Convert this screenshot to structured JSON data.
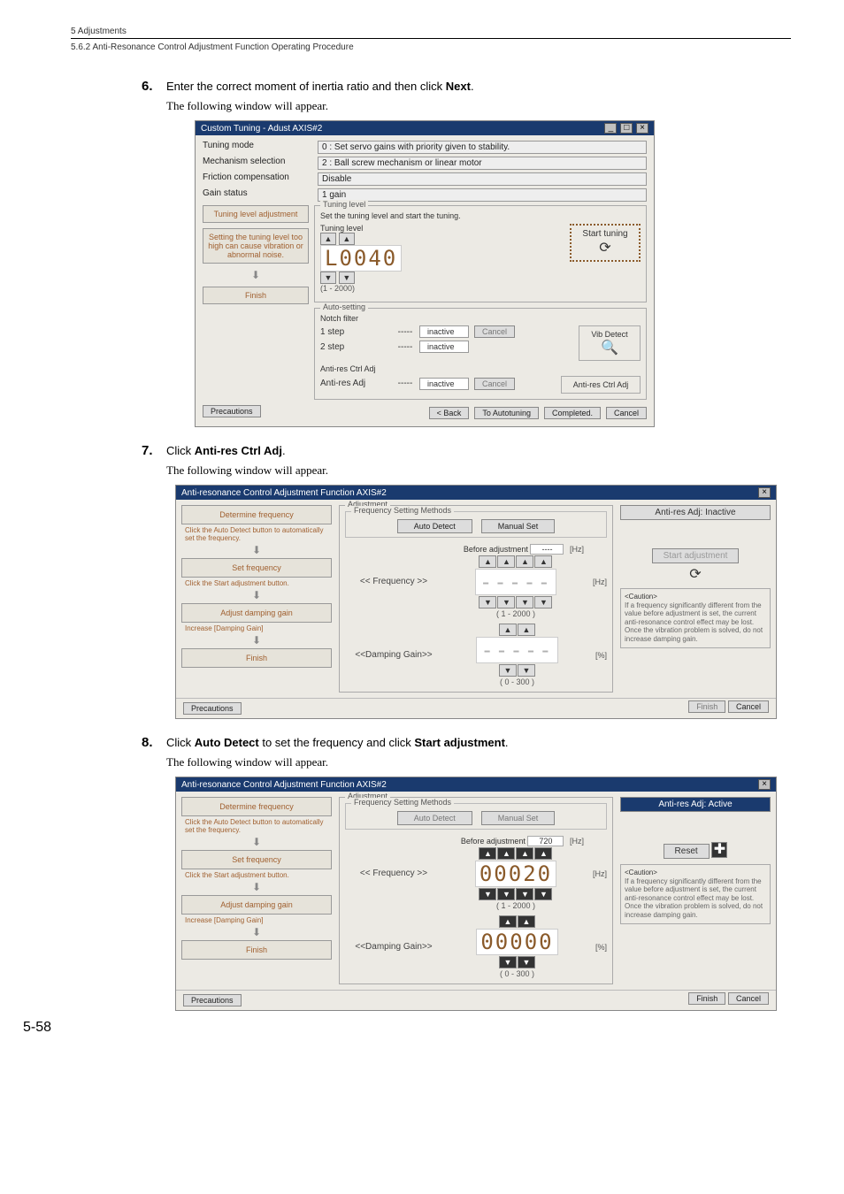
{
  "doc": {
    "section": "5  Adjustments",
    "subsection": "5.6.2  Anti-Resonance Control Adjustment Function Operating Procedure",
    "page": "5-58"
  },
  "steps": [
    {
      "num": "6.",
      "text_a": "Enter the correct moment of inertia ratio and then click ",
      "bold": "Next",
      "text_b": ".",
      "sub": "The following window will appear."
    },
    {
      "num": "7.",
      "text_a": "Click ",
      "bold": "Anti-res Ctrl Adj",
      "text_b": ".",
      "sub": "The following window will appear."
    },
    {
      "num": "8.",
      "text_a": "Click ",
      "bold_a": "Auto Detect",
      "text_b": " to set the frequency and click ",
      "bold_b": "Start adjustment",
      "text_c": ".",
      "sub": "The following window will appear."
    }
  ],
  "win1": {
    "title": "Custom Tuning - Adust AXIS#2",
    "rows": [
      {
        "label": "Tuning mode",
        "val": "0 : Set servo gains with priority given to stability."
      },
      {
        "label": "Mechanism selection",
        "val": "2 : Ball screw mechanism or linear motor"
      },
      {
        "label": "Friction compensation",
        "val": "Disable"
      },
      {
        "label": "Gain status",
        "val": "1 gain"
      }
    ],
    "flow": [
      "Tuning level adjustment",
      "Setting the tuning level too high can cause vibration or abnormal noise.",
      "Finish"
    ],
    "tuning": {
      "group": "Tuning level",
      "hint": "Set the tuning level and start the tuning.",
      "label": "Tuning level",
      "value": "L0040",
      "range": "(1 - 2000)",
      "start": "Start tuning"
    },
    "auto": {
      "group": "Auto-setting",
      "notch": "Notch filter",
      "rows": [
        {
          "label": "1 step",
          "dots": "-----",
          "status": "inactive"
        },
        {
          "label": "2 step",
          "dots": "-----",
          "status": "inactive"
        }
      ],
      "cancel": "Cancel",
      "vib": "Vib Detect",
      "anti_label": "Anti-res Ctrl Adj",
      "anti_row": {
        "label": "Anti-res Adj",
        "dots": "-----",
        "status": "inactive"
      },
      "anti_btn": "Anti-res Ctrl Adj"
    },
    "bottom": {
      "precautions": "Precautions",
      "back": "< Back",
      "auto": "To Autotuning",
      "completed": "Completed.",
      "cancel": "Cancel"
    }
  },
  "win2": {
    "title": "Anti-resonance Control Adjustment Function AXIS#2",
    "flow": {
      "determine": "Determine frequency",
      "note1": "Click the Auto Detect button to automatically set the frequency.",
      "setfreq": "Set frequency",
      "note2": "Click the Start adjustment button.",
      "adjust": "Adjust damping gain",
      "note3": "Increase [Damping Gain]",
      "finish": "Finish"
    },
    "mid": {
      "group": "Adjustment",
      "methods": "Frequency Setting Methods",
      "auto_detect": "Auto Detect",
      "manual_set": "Manual Set",
      "before": "Before adjustment",
      "before_val": "----",
      "hz": "[Hz]",
      "pct": "[%]",
      "freq_label": "<<  Frequency  >>",
      "freq_val": "-----",
      "freq_range": "( 1 - 2000 )",
      "damp_label": "<<Damping Gain>>",
      "damp_val": "-----",
      "damp_range": "( 0 - 300 )"
    },
    "right": {
      "badge": "Anti-res Adj: Inactive",
      "start": "Start adjustment",
      "caution_t": "<Caution>",
      "caution": "If a frequency significantly different from the value before adjustment is set, the current anti-resonance control effect may be lost. Once the vibration problem is solved, do not increase damping gain."
    },
    "footer": {
      "precautions": "Precautions",
      "finish": "Finish",
      "cancel": "Cancel"
    }
  },
  "win3": {
    "title": "Anti-resonance Control Adjustment Function AXIS#2",
    "mid": {
      "before_val": "720",
      "freq_val": "00020",
      "damp_val": "00000"
    },
    "right": {
      "badge": "Anti-res Adj: Active",
      "reset": "Reset"
    }
  }
}
